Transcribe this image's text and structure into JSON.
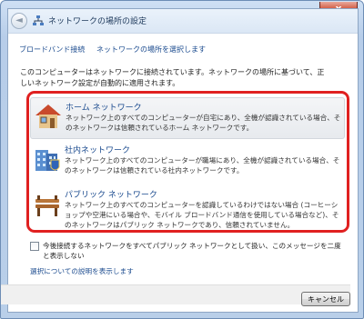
{
  "window": {
    "title": "ネットワークの場所の設定",
    "close_glyph": "x"
  },
  "breadcrumb": {
    "items": [
      "ブロードバンド接続",
      "ネットワークの場所を選択します"
    ]
  },
  "description": "このコンピューターはネットワークに接続されています。ネットワークの場所に基づいて、正しいネットワーク設定が自動的に適用されます。",
  "options": [
    {
      "title": "ホーム ネットワーク",
      "description": "ネットワーク上のすべてのコンピューターが自宅にあり、全機が認識されている場合、そのネットワークは信頼されているホーム ネットワークです。",
      "icon": "home-network-icon"
    },
    {
      "title": "社内ネットワーク",
      "description": "ネットワーク上のすべてのコンピューターが職場にあり、全機が認識されている場合、そのネットワークは信頼されている社内ネットワークです。",
      "icon": "work-network-icon"
    },
    {
      "title": "パブリック ネットワーク",
      "description": "ネットワーク上のすべてのコンピューターを認識しているわけではない場合 (コーヒーショップや空港にいる場合や、モバイル ブロードバンド通信を使用している場合など)、そのネットワークはパブリック ネットワークであり、信頼されていません。",
      "icon": "public-network-icon"
    }
  ],
  "checkbox": {
    "label": "今後接続するネットワークをすべてパブリック ネットワークとして扱い、このメッセージを二度と表示しない",
    "checked": false
  },
  "help_link": "選択についての説明を表示します",
  "cancel_label": "キャンセル",
  "colors": {
    "highlight_frame": "#e02020",
    "link": "#1a4a8e",
    "title_bar": "#dbe7f5"
  }
}
